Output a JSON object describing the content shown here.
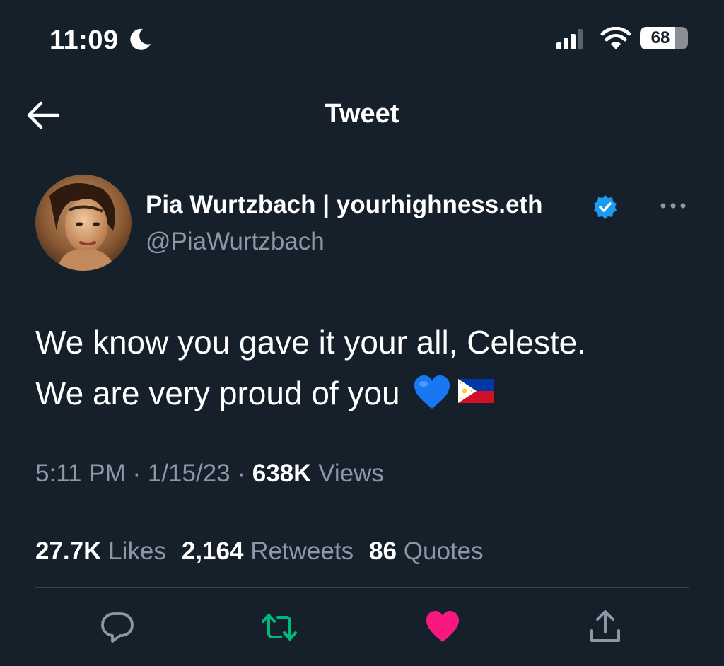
{
  "status_bar": {
    "time": "11:09",
    "battery": "68"
  },
  "header": {
    "title": "Tweet"
  },
  "author": {
    "name": "Pia Wurtzbach | yourhighness.eth",
    "handle": "@PiaWurtzbach",
    "verified": true
  },
  "tweet": {
    "line1": "We know you gave it your all, Celeste.",
    "line2": "We are very proud of you",
    "emojis": [
      "blue-heart",
      "philippines-flag"
    ]
  },
  "meta": {
    "time": "5:11 PM",
    "sep1": " · ",
    "date": "1/15/23",
    "sep2": " · ",
    "views_count": "638K",
    "views_label": "Views"
  },
  "stats": {
    "likes_count": "27.7K",
    "likes_label": "Likes",
    "retweets_count": "2,164",
    "retweets_label": "Retweets",
    "quotes_count": "86",
    "quotes_label": "Quotes"
  },
  "colors": {
    "background": "#15202b",
    "secondary_text": "#8b98a5",
    "verified": "#1d9bf0",
    "retweet": "#00ba7c",
    "like": "#f91880",
    "divider": "#38444d"
  },
  "icons": [
    "moon-icon",
    "signal-icon",
    "wifi-icon",
    "battery-icon",
    "back-arrow-icon",
    "verified-badge-icon",
    "more-icon",
    "reply-icon",
    "retweet-icon",
    "like-icon",
    "share-icon"
  ]
}
